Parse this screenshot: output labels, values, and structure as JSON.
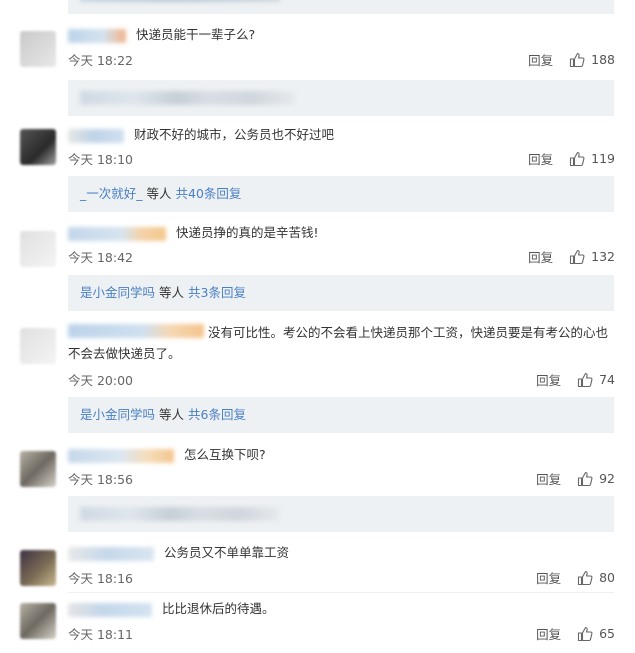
{
  "ui": {
    "reply_label": "回复",
    "others_suffix": "等人",
    "colors": {
      "link": "#4a7fc4",
      "reply_bg": "#eef1f3",
      "text": "#333333",
      "meta": "#666666"
    }
  },
  "comments": [
    {
      "text": "快递员能干一辈子么?",
      "time": "今天 18:22",
      "likes": "188",
      "reply": {
        "type": "blurred"
      }
    },
    {
      "text": "财政不好的城市，公务员也不好过吧",
      "time": "今天 18:10",
      "likes": "119",
      "reply": {
        "user": "_一次就好_",
        "others": "等人",
        "count": "共40条回复"
      }
    },
    {
      "text": "快递员挣的真的是辛苦钱!",
      "time": "今天 18:42",
      "likes": "132",
      "reply": {
        "user": "是小金同学吗",
        "others": "等人",
        "count": "共3条回复"
      }
    },
    {
      "text": "没有可比性。考公的不会看上快递员那个工资，快递员要是有考公的心也不会去做快递员了。",
      "time": "今天 20:00",
      "likes": "74",
      "reply": {
        "user": "是小金同学吗",
        "others": "等人",
        "count": "共6条回复"
      }
    },
    {
      "text": "怎么互换下呗?",
      "time": "今天 18:56",
      "likes": "92",
      "reply": {
        "type": "blurred"
      }
    },
    {
      "text": "公务员又不单单靠工资",
      "time": "今天 18:16",
      "likes": "80"
    },
    {
      "text": "比比退休后的待遇。",
      "time": "今天 18:11",
      "likes": "65"
    }
  ]
}
